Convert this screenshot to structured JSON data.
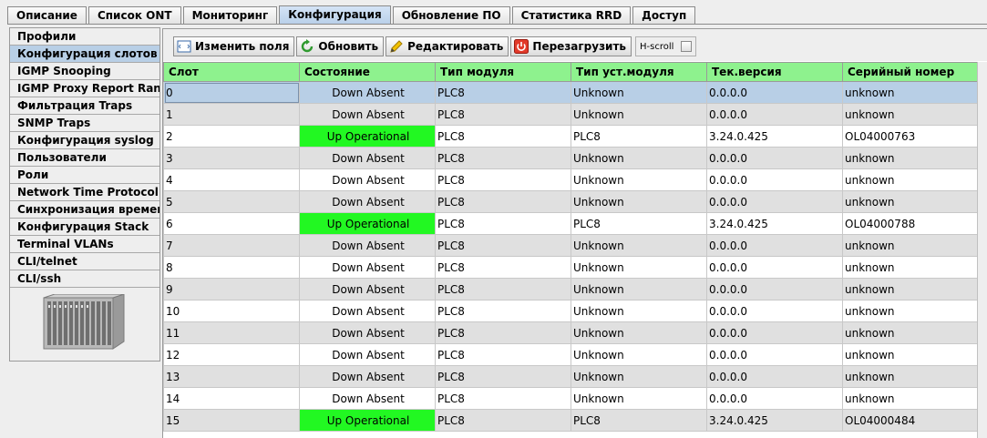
{
  "tabs": [
    "Описание",
    "Список ONT",
    "Мониторинг",
    "Конфигурация",
    "Обновление ПО",
    "Статистика RRD",
    "Доступ"
  ],
  "active_tab": 3,
  "sidebar": {
    "items": [
      "Профили",
      "Конфигурация слотов",
      "IGMP Snooping",
      "IGMP Proxy Report Range",
      "Фильтрация Traps",
      "SNMP Traps",
      "Конфигурация syslog",
      "Пользователи",
      "Роли",
      "Network Time Protocol",
      "Синхронизация времени",
      "Конфигурация Stack",
      "Terminal VLANs",
      "CLI/telnet",
      "CLI/ssh"
    ],
    "active": 1
  },
  "toolbar": {
    "edit_fields": "Изменить поля",
    "refresh": "Обновить",
    "edit": "Редактировать",
    "reboot": "Перезагрузить",
    "hscroll": "H-scroll"
  },
  "table": {
    "columns": [
      "Слот",
      "Состояние",
      "Тип модуля",
      "Тип уст.модуля",
      "Тек.версия",
      "Серийный номер"
    ],
    "rows": [
      [
        "0",
        "Down Absent",
        "PLC8",
        "Unknown",
        "0.0.0.0",
        "unknown"
      ],
      [
        "1",
        "Down Absent",
        "PLC8",
        "Unknown",
        "0.0.0.0",
        "unknown"
      ],
      [
        "2",
        "Up Operational",
        "PLC8",
        "PLC8",
        "3.24.0.425",
        "OL04000763"
      ],
      [
        "3",
        "Down Absent",
        "PLC8",
        "Unknown",
        "0.0.0.0",
        "unknown"
      ],
      [
        "4",
        "Down Absent",
        "PLC8",
        "Unknown",
        "0.0.0.0",
        "unknown"
      ],
      [
        "5",
        "Down Absent",
        "PLC8",
        "Unknown",
        "0.0.0.0",
        "unknown"
      ],
      [
        "6",
        "Up Operational",
        "PLC8",
        "PLC8",
        "3.24.0.425",
        "OL04000788"
      ],
      [
        "7",
        "Down Absent",
        "PLC8",
        "Unknown",
        "0.0.0.0",
        "unknown"
      ],
      [
        "8",
        "Down Absent",
        "PLC8",
        "Unknown",
        "0.0.0.0",
        "unknown"
      ],
      [
        "9",
        "Down Absent",
        "PLC8",
        "Unknown",
        "0.0.0.0",
        "unknown"
      ],
      [
        "10",
        "Down Absent",
        "PLC8",
        "Unknown",
        "0.0.0.0",
        "unknown"
      ],
      [
        "11",
        "Down Absent",
        "PLC8",
        "Unknown",
        "0.0.0.0",
        "unknown"
      ],
      [
        "12",
        "Down Absent",
        "PLC8",
        "Unknown",
        "0.0.0.0",
        "unknown"
      ],
      [
        "13",
        "Down Absent",
        "PLC8",
        "Unknown",
        "0.0.0.0",
        "unknown"
      ],
      [
        "14",
        "Down Absent",
        "PLC8",
        "Unknown",
        "0.0.0.0",
        "unknown"
      ],
      [
        "15",
        "Up Operational",
        "PLC8",
        "PLC8",
        "3.24.0.425",
        "OL04000484"
      ]
    ],
    "selected_row": 0
  },
  "colors": {
    "header_bg": "#8ef28e",
    "up_state": "#22f822",
    "selection": "#b8cfe6"
  },
  "icons": [
    "fields-icon",
    "refresh-icon",
    "pencil-icon",
    "power-icon",
    "checkbox-icon",
    "device-chassis-image"
  ]
}
